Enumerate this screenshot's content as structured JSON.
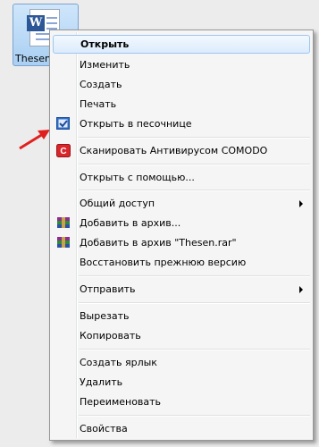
{
  "desktop": {
    "file_label": "Thesen"
  },
  "menu": {
    "items": [
      {
        "label": "Открыть"
      },
      {
        "label": "Изменить"
      },
      {
        "label": "Создать"
      },
      {
        "label": "Печать"
      },
      {
        "label": "Открыть в песочнице"
      },
      {
        "label": "Сканировать Антивирусом COMODO"
      },
      {
        "label": "Открыть с помощью..."
      },
      {
        "label": "Общий доступ"
      },
      {
        "label": "Добавить в архив..."
      },
      {
        "label": "Добавить в архив \"Thesen.rar\""
      },
      {
        "label": "Восстановить прежнюю версию"
      },
      {
        "label": "Отправить"
      },
      {
        "label": "Вырезать"
      },
      {
        "label": "Копировать"
      },
      {
        "label": "Создать ярлык"
      },
      {
        "label": "Удалить"
      },
      {
        "label": "Переименовать"
      },
      {
        "label": "Свойства"
      }
    ]
  },
  "colors": {
    "highlight_border": "#9cc7f0",
    "arrow": "#e0201e",
    "comodo_red": "#d9262b",
    "sandbox_blue": "#2f6fc9"
  }
}
